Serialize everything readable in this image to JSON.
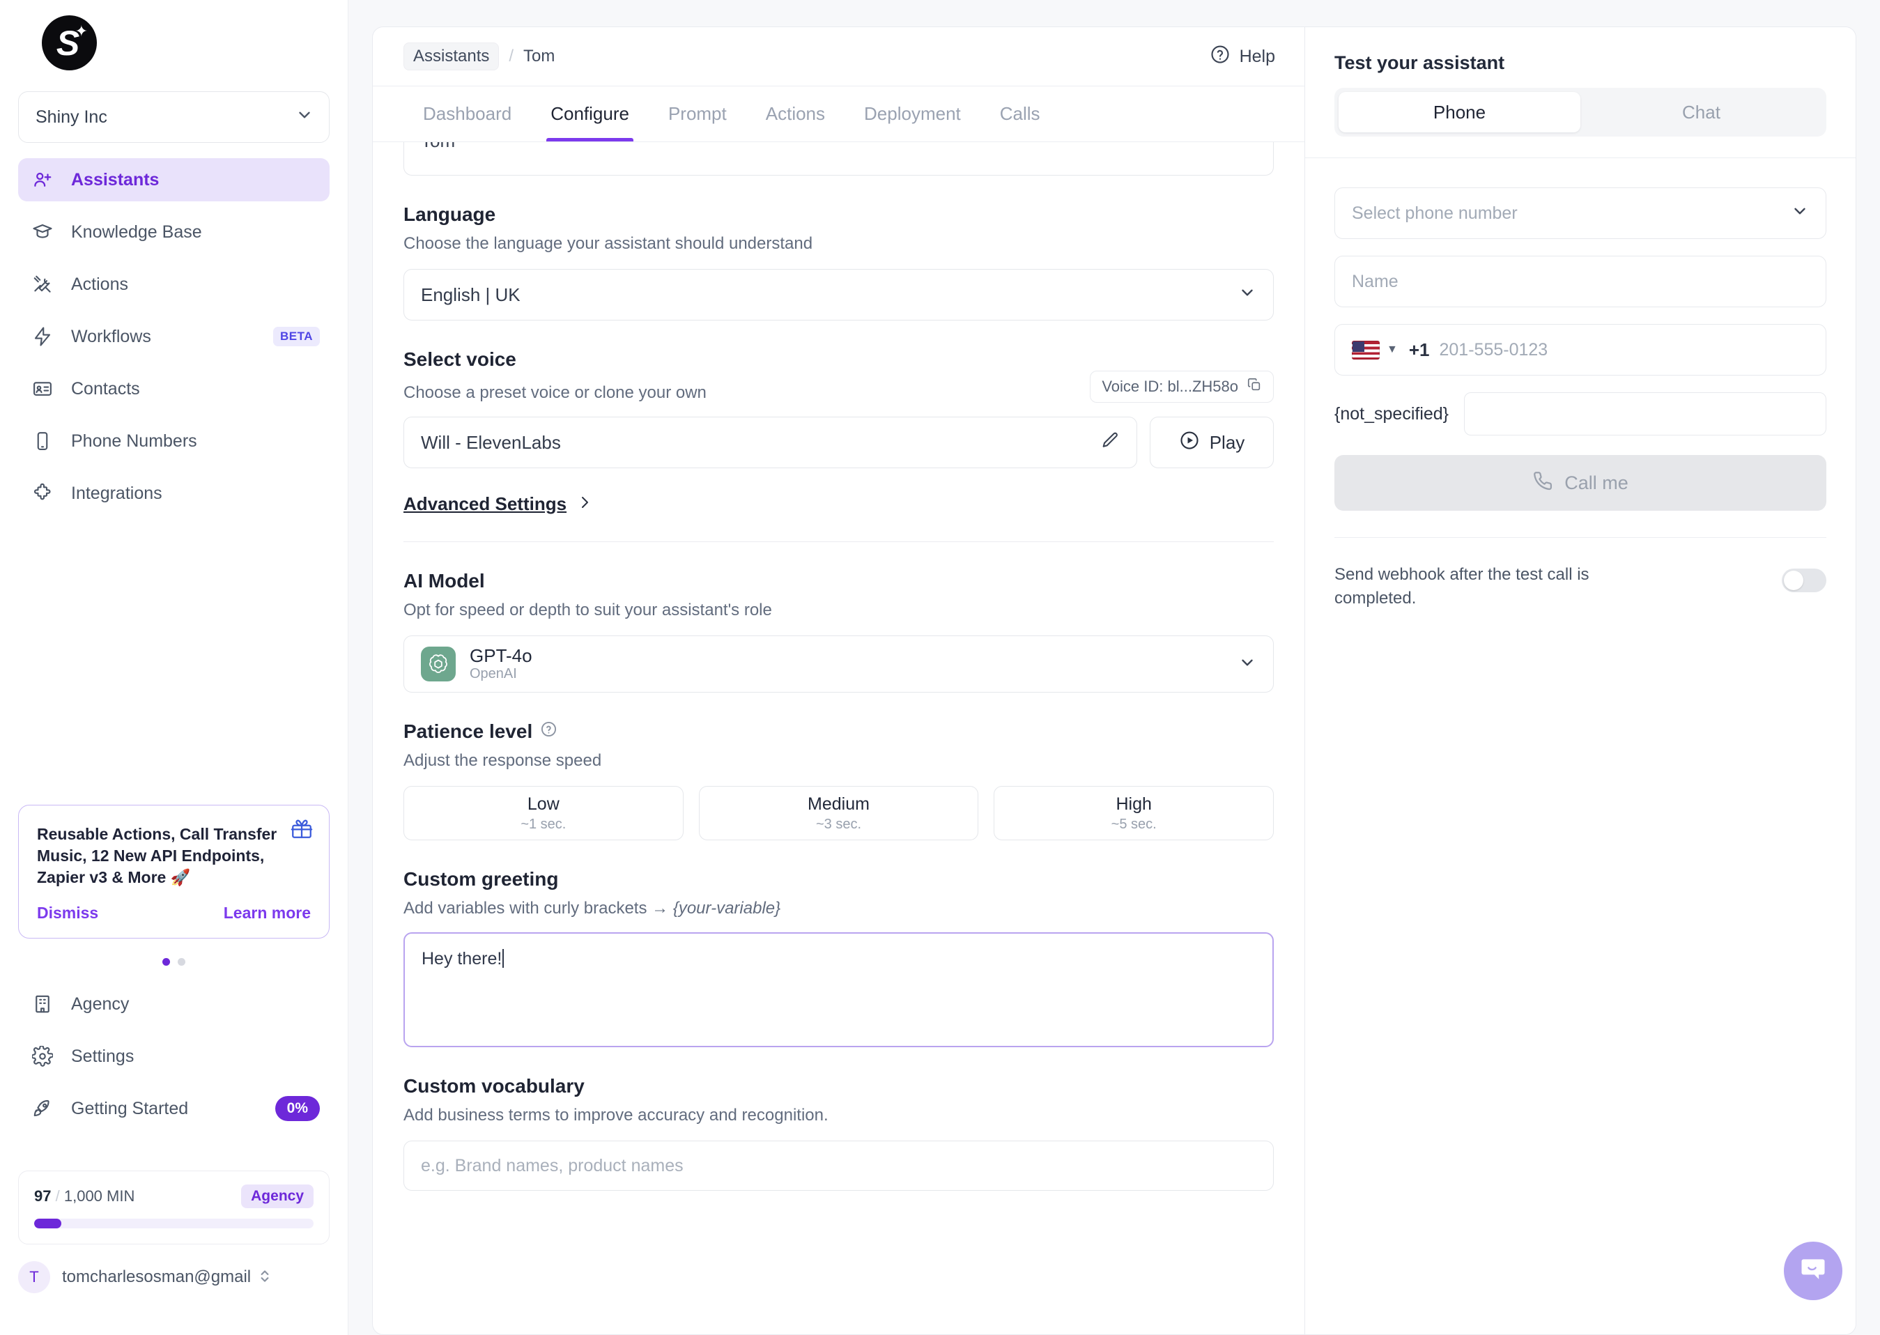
{
  "brand": {
    "logo_letter": "S",
    "accent": "#6d28d9"
  },
  "sidebar": {
    "org": {
      "name": "Shiny Inc"
    },
    "nav": [
      {
        "label": "Assistants",
        "icon": "user-plus-icon",
        "active": true
      },
      {
        "label": "Knowledge Base",
        "icon": "graduation-cap-icon",
        "active": false
      },
      {
        "label": "Actions",
        "icon": "tools-icon",
        "active": false
      },
      {
        "label": "Workflows",
        "icon": "bolt-icon",
        "badge": "BETA",
        "active": false
      },
      {
        "label": "Contacts",
        "icon": "contact-card-icon",
        "active": false
      },
      {
        "label": "Phone Numbers",
        "icon": "phone-device-icon",
        "active": false
      },
      {
        "label": "Integrations",
        "icon": "puzzle-icon",
        "active": false
      }
    ],
    "promo": {
      "text": "Reusable Actions, Call Transfer Music, 12 New API Endpoints, Zapier v3 & More 🚀",
      "dismiss": "Dismiss",
      "learn_more": "Learn more"
    },
    "bottom_nav": [
      {
        "label": "Agency",
        "icon": "building-icon"
      },
      {
        "label": "Settings",
        "icon": "gear-icon"
      },
      {
        "label": "Getting Started",
        "icon": "rocket-icon",
        "progress": "0%"
      }
    ],
    "usage": {
      "used": "97",
      "separator": "/",
      "total": "1,000 MIN",
      "plan": "Agency",
      "percent": 9.7
    },
    "account": {
      "initial": "T",
      "email": "tomcharlesosman@gmail"
    }
  },
  "header": {
    "breadcrumb_root": "Assistants",
    "breadcrumb_sep": "/",
    "breadcrumb_current": "Tom",
    "help_label": "Help"
  },
  "tabs": [
    {
      "label": "Dashboard",
      "active": false
    },
    {
      "label": "Configure",
      "active": true
    },
    {
      "label": "Prompt",
      "active": false
    },
    {
      "label": "Actions",
      "active": false
    },
    {
      "label": "Deployment",
      "active": false
    },
    {
      "label": "Calls",
      "active": false
    }
  ],
  "configure": {
    "name_field_value": "Tom",
    "language": {
      "title": "Language",
      "subtitle": "Choose the language your assistant should understand",
      "value": "English | UK"
    },
    "voice": {
      "title": "Select voice",
      "subtitle": "Choose a preset voice or clone your own",
      "voice_id_label": "Voice ID: bl...ZH58o",
      "value": "Will - ElevenLabs",
      "play_label": "Play"
    },
    "advanced_settings": "Advanced Settings",
    "ai_model": {
      "title": "AI Model",
      "subtitle": "Opt for speed or depth to suit your assistant's role",
      "name": "GPT-4o",
      "vendor": "OpenAI"
    },
    "patience": {
      "title": "Patience level",
      "subtitle": "Adjust the response speed",
      "options": [
        {
          "label": "Low",
          "detail": "~1 sec."
        },
        {
          "label": "Medium",
          "detail": "~3 sec."
        },
        {
          "label": "High",
          "detail": "~5 sec."
        }
      ]
    },
    "greeting": {
      "title": "Custom greeting",
      "subtitle": "Add variables with curly brackets → ",
      "subtitle_var": "{your-variable}",
      "value": "Hey there!"
    },
    "vocabulary": {
      "title": "Custom vocabulary",
      "subtitle": "Add business terms to improve accuracy and recognition.",
      "placeholder": "e.g. Brand names, product names"
    }
  },
  "test_panel": {
    "title": "Test your assistant",
    "modes": [
      {
        "label": "Phone",
        "active": true
      },
      {
        "label": "Chat",
        "active": false
      }
    ],
    "phone_select_placeholder": "Select phone number",
    "name_placeholder": "Name",
    "dial_code": "+1",
    "phone_placeholder": "201-555-0123",
    "variable_name": "{not_specified}",
    "variable_value": "",
    "call_button": "Call me",
    "webhook_label": "Send webhook after the test call is completed.",
    "webhook_on": false
  },
  "fab": {
    "icon": "chat-bubble-icon"
  }
}
